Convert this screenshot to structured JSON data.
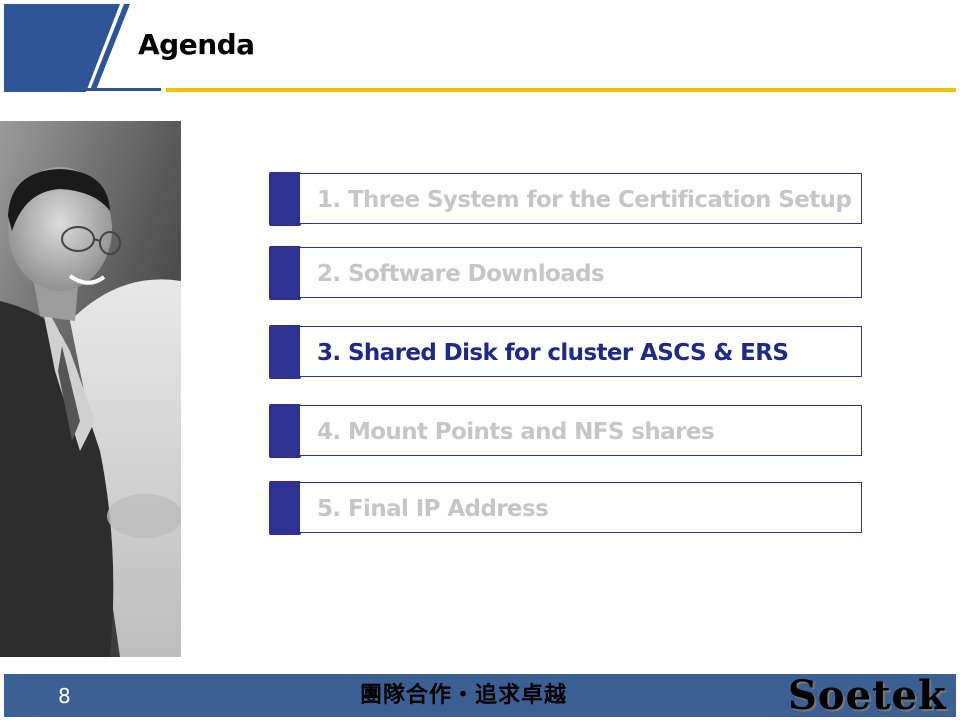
{
  "header": {
    "title": "Agenda",
    "accent_color": "#2f5597",
    "rule_color": "#f2c200"
  },
  "agenda": {
    "items": [
      {
        "label": "1. Three System for the Certification Setup",
        "active": false
      },
      {
        "label": "2. Software Downloads",
        "active": false
      },
      {
        "label": "3. Shared Disk for cluster ASCS & ERS",
        "active": true
      },
      {
        "label": "4. Mount Points and NFS shares",
        "active": false
      },
      {
        "label": "5. Final IP Address",
        "active": false
      }
    ],
    "tab_color": "#2e3192",
    "active_text_color": "#1f2a86",
    "inactive_text_color": "#c6c6c6"
  },
  "footer": {
    "page_number": "8",
    "slogan": "團隊合作・追求卓越",
    "logo": "Soetek",
    "background_color": "#3c5f94"
  },
  "photo": {
    "icon": "business-man-photo"
  }
}
